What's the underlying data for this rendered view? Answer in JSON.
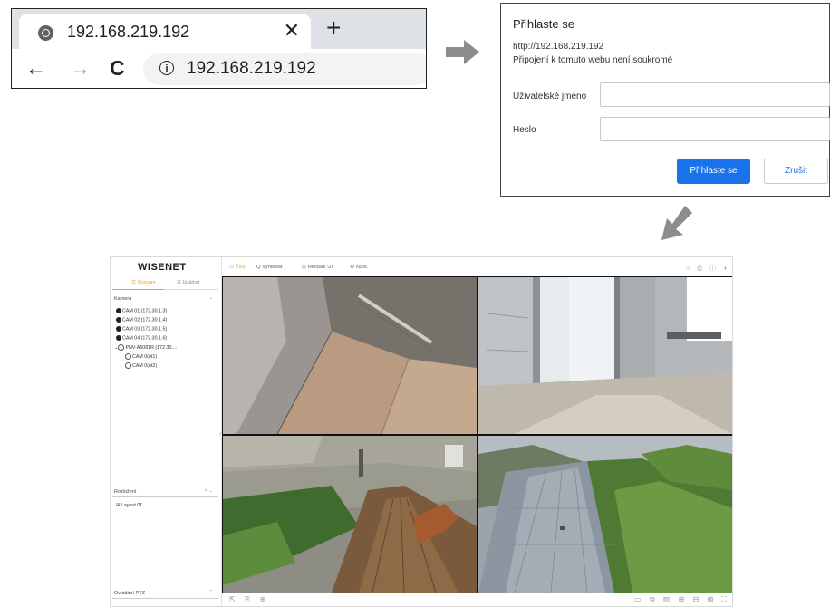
{
  "browser": {
    "tab_title": "192.168.219.192",
    "close_glyph": "✕",
    "newtab_glyph": "+",
    "back_glyph": "←",
    "forward_glyph": "→",
    "reload_glyph": "C",
    "info_glyph": "i",
    "address": "192.168.219.192"
  },
  "login": {
    "title": "Přihlaste se",
    "url": "http://192.168.219.192",
    "note": "Připojení k tomuto webu není soukromé",
    "username_label": "Uživatelské jméno",
    "password_label": "Heslo",
    "username_value": "",
    "password_value": "",
    "login_button": "Přihlaste se",
    "cancel_button": "Zrušit",
    "accent": "#1a73e8"
  },
  "viewer": {
    "logo": "WISENET",
    "accent": "#f59a23",
    "sidebar_tabs": [
      "☰ Seznam",
      "☷ Událost"
    ],
    "camera_section": "Kamera",
    "cameras": [
      "CAM 01 (172.30.1.3)",
      "CAM 02 (172.30.1.4)",
      "CAM 03 (172.30.1.5)",
      "CAM 04 (172.30.1.6)"
    ],
    "nvr": "PNV-A6081R (172.30....",
    "nvr_channels": [
      "CAM 0(ot1)",
      "CAM 0(ot2)"
    ],
    "layout_section": "Rozložení",
    "layout_item": "Layout 01",
    "ptz_section": "Ovládání PTZ",
    "menu": [
      "▭ Živý",
      "Q Vyhledat",
      "◎ Hledání UI",
      "⚙ Nast."
    ],
    "top_icons": [
      "⌂",
      "⎙",
      "ⓘ",
      "◑"
    ],
    "bottom_left_icons": [
      "⇱",
      "⎘",
      "⊕"
    ],
    "bottom_right_icons": [
      "▭",
      "⧉",
      "▥",
      "⊞",
      "⊟",
      "⊠",
      "⛶"
    ]
  }
}
